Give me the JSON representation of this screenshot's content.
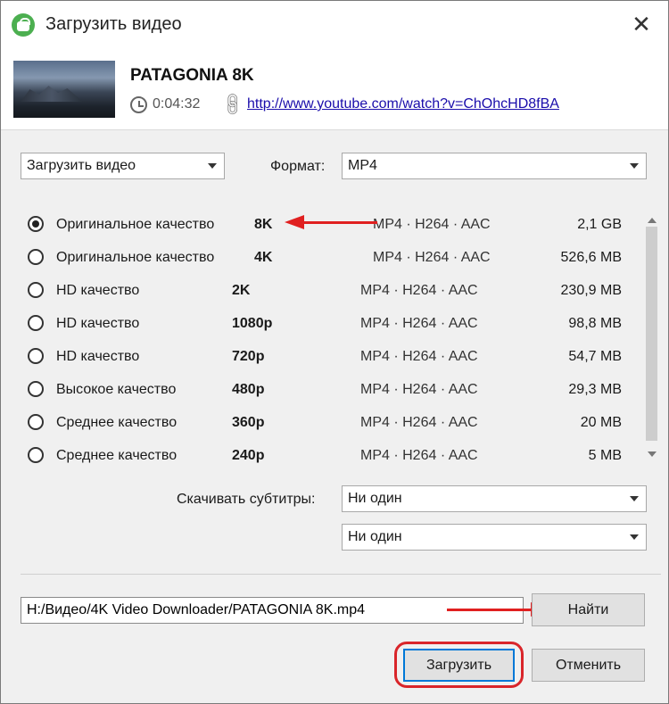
{
  "window": {
    "title": "Загрузить видео",
    "close_glyph": "✕"
  },
  "video": {
    "title": "PATAGONIA 8K",
    "duration": "0:04:32",
    "url": "http://www.youtube.com/watch?v=ChOhcHD8fBA"
  },
  "controls": {
    "mode_select": "Загрузить видео",
    "format_label": "Формат:",
    "format_select": "MP4"
  },
  "qualities": [
    {
      "label": "Оригинальное качество",
      "resolution": "8K",
      "codec": "MP4 · H264 · AAC",
      "size": "2,1 GB",
      "selected": true
    },
    {
      "label": "Оригинальное качество",
      "resolution": "4K",
      "codec": "MP4 · H264 · AAC",
      "size": "526,6 MB",
      "selected": false
    },
    {
      "label": "HD качество",
      "resolution": "2K",
      "codec": "MP4 · H264 · AAC",
      "size": "230,9 MB",
      "selected": false
    },
    {
      "label": "HD качество",
      "resolution": "1080p",
      "codec": "MP4 · H264 · AAC",
      "size": "98,8 MB",
      "selected": false
    },
    {
      "label": "HD качество",
      "resolution": "720p",
      "codec": "MP4 · H264 · AAC",
      "size": "54,7 MB",
      "selected": false
    },
    {
      "label": "Высокое качество",
      "resolution": "480p",
      "codec": "MP4 · H264 · AAC",
      "size": "29,3 MB",
      "selected": false
    },
    {
      "label": "Среднее качество",
      "resolution": "360p",
      "codec": "MP4 · H264 · AAC",
      "size": "20 MB",
      "selected": false
    },
    {
      "label": "Среднее качество",
      "resolution": "240p",
      "codec": "MP4 · H264 · AAC",
      "size": "5 MB",
      "selected": false
    }
  ],
  "subtitles": {
    "label": "Скачивать субтитры:",
    "select1": "Ни один",
    "select2": "Ни один"
  },
  "output": {
    "path": "H:/Видео/4K Video Downloader/PATAGONIA 8K.mp4",
    "browse_label": "Найти"
  },
  "actions": {
    "download_label": "Загрузить",
    "cancel_label": "Отменить"
  },
  "colors": {
    "accent": "#0078d7",
    "annotation": "#d9252a",
    "link": "#1a0dab"
  }
}
